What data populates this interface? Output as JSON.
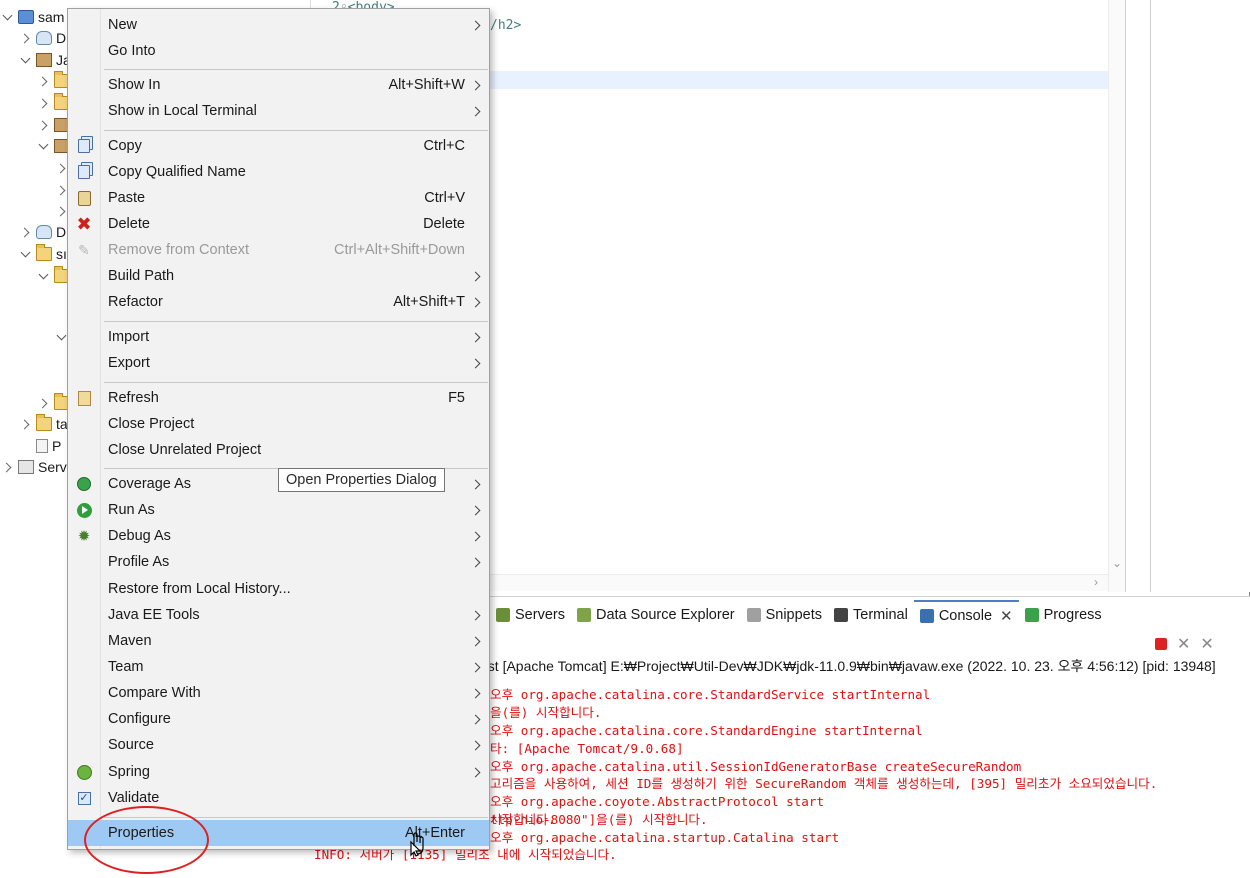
{
  "tree": {
    "items": [
      {
        "label": "sam",
        "indent": 0,
        "chevron": "down",
        "icon": "project-icon"
      },
      {
        "label": "D",
        "indent": 1,
        "chevron": "right",
        "icon": "descriptor-icon"
      },
      {
        "label": "Ja",
        "indent": 1,
        "chevron": "down",
        "icon": "java-resources-icon"
      },
      {
        "label": "",
        "indent": 2,
        "chevron": "right",
        "icon": "package-folder-icon"
      },
      {
        "label": "",
        "indent": 2,
        "chevron": "right",
        "icon": "package-folder-icon"
      },
      {
        "label": "",
        "indent": 2,
        "chevron": "right",
        "icon": "library-icon"
      },
      {
        "label": "",
        "indent": 2,
        "chevron": "down",
        "icon": "library-icon"
      },
      {
        "label": "",
        "indent": 3,
        "chevron": "right",
        "icon": ""
      },
      {
        "label": "",
        "indent": 3,
        "chevron": "right",
        "icon": ""
      },
      {
        "label": "",
        "indent": 3,
        "chevron": "right",
        "icon": ""
      },
      {
        "label": "D",
        "indent": 1,
        "chevron": "right",
        "icon": "deployed-resources-icon"
      },
      {
        "label": "sı",
        "indent": 1,
        "chevron": "down",
        "icon": "folder-icon"
      },
      {
        "label": "",
        "indent": 2,
        "chevron": "down",
        "icon": "folder-icon"
      },
      {
        "label": "",
        "indent": 3,
        "chevron": "down",
        "icon": ""
      },
      {
        "label": "",
        "indent": 2,
        "chevron": "right",
        "icon": "folder-icon"
      },
      {
        "label": "ta",
        "indent": 1,
        "chevron": "right",
        "icon": "folder-icon"
      },
      {
        "label": "P",
        "indent": 1,
        "chevron": "",
        "icon": "pom-file-icon"
      },
      {
        "label": "Serv",
        "indent": 0,
        "chevron": "right",
        "icon": "servers-folder-icon"
      }
    ]
  },
  "editor": {
    "lines": [
      "2◦<body>",
      "/h2>"
    ]
  },
  "context_menu": {
    "items": [
      {
        "label": "New",
        "key": "",
        "submenu": true,
        "icon": "",
        "state": "enabled"
      },
      {
        "label": "Go Into",
        "key": "",
        "submenu": false,
        "icon": "",
        "state": "enabled"
      },
      {
        "label": "Show In",
        "key": "Alt+Shift+W",
        "submenu": true,
        "icon": "",
        "state": "enabled"
      },
      {
        "label": "Show in Local Terminal",
        "key": "",
        "submenu": true,
        "icon": "",
        "state": "enabled"
      },
      {
        "label": "Copy",
        "key": "Ctrl+C",
        "submenu": false,
        "icon": "copy-icon",
        "state": "enabled"
      },
      {
        "label": "Copy Qualified Name",
        "key": "",
        "submenu": false,
        "icon": "copy-qualified-icon",
        "state": "enabled"
      },
      {
        "label": "Paste",
        "key": "Ctrl+V",
        "submenu": false,
        "icon": "paste-icon",
        "state": "enabled"
      },
      {
        "label": "Delete",
        "key": "Delete",
        "submenu": false,
        "icon": "delete-icon",
        "state": "enabled"
      },
      {
        "label": "Remove from Context",
        "key": "Ctrl+Alt+Shift+Down",
        "submenu": false,
        "icon": "remove-context-icon",
        "state": "disabled"
      },
      {
        "label": "Build Path",
        "key": "",
        "submenu": true,
        "icon": "",
        "state": "enabled"
      },
      {
        "label": "Refactor",
        "key": "Alt+Shift+T",
        "submenu": true,
        "icon": "",
        "state": "enabled"
      },
      {
        "label": "Import",
        "key": "",
        "submenu": true,
        "icon": "",
        "state": "enabled"
      },
      {
        "label": "Export",
        "key": "",
        "submenu": true,
        "icon": "",
        "state": "enabled"
      },
      {
        "label": "Refresh",
        "key": "F5",
        "submenu": false,
        "icon": "refresh-icon",
        "state": "enabled"
      },
      {
        "label": "Close Project",
        "key": "",
        "submenu": false,
        "icon": "",
        "state": "enabled"
      },
      {
        "label": "Close Unrelated Project",
        "key": "",
        "submenu": false,
        "icon": "",
        "state": "enabled"
      },
      {
        "label": "Coverage As",
        "key": "",
        "submenu": true,
        "icon": "coverage-icon",
        "state": "enabled"
      },
      {
        "label": "Run As",
        "key": "",
        "submenu": true,
        "icon": "run-icon",
        "state": "enabled"
      },
      {
        "label": "Debug As",
        "key": "",
        "submenu": true,
        "icon": "debug-icon",
        "state": "enabled"
      },
      {
        "label": "Profile As",
        "key": "",
        "submenu": true,
        "icon": "",
        "state": "enabled"
      },
      {
        "label": "Restore from Local History...",
        "key": "",
        "submenu": false,
        "icon": "",
        "state": "enabled"
      },
      {
        "label": "Java EE Tools",
        "key": "",
        "submenu": true,
        "icon": "",
        "state": "enabled"
      },
      {
        "label": "Maven",
        "key": "",
        "submenu": true,
        "icon": "",
        "state": "enabled"
      },
      {
        "label": "Team",
        "key": "",
        "submenu": true,
        "icon": "",
        "state": "enabled"
      },
      {
        "label": "Compare With",
        "key": "",
        "submenu": true,
        "icon": "",
        "state": "enabled"
      },
      {
        "label": "Configure",
        "key": "",
        "submenu": true,
        "icon": "",
        "state": "enabled"
      },
      {
        "label": "Source",
        "key": "",
        "submenu": true,
        "icon": "",
        "state": "enabled"
      },
      {
        "label": "Spring",
        "key": "",
        "submenu": true,
        "icon": "spring-icon",
        "state": "enabled"
      },
      {
        "label": "Validate",
        "key": "",
        "submenu": false,
        "icon": "validate-checkbox-icon",
        "state": "enabled"
      },
      {
        "label": "Properties",
        "key": "Alt+Enter",
        "submenu": false,
        "icon": "",
        "state": "selected"
      }
    ]
  },
  "tooltip": {
    "text": "Open Properties Dialog"
  },
  "bottom_tabs": [
    {
      "label": "Servers",
      "icon": "servers-icon",
      "active": false
    },
    {
      "label": "Data Source Explorer",
      "icon": "data-source-icon",
      "active": false
    },
    {
      "label": "Snippets",
      "icon": "snippets-icon",
      "active": false
    },
    {
      "label": "Terminal",
      "icon": "terminal-icon",
      "active": false
    },
    {
      "label": "Console",
      "icon": "console-icon",
      "active": true
    },
    {
      "label": "Progress",
      "icon": "progress-icon",
      "active": false
    }
  ],
  "console": {
    "header": "ost [Apache Tomcat] E:₩Project₩Util-Dev₩JDK₩jdk-11.0.9₩bin₩javaw.exe  (2022. 10. 23. 오후 4:56:12) [pid: 13948]",
    "lines": [
      "오후 org.apache.catalina.core.StandardService startInternal",
      "을(를) 시작합니다.",
      "오후 org.apache.catalina.core.StandardEngine startInternal",
      "타: [Apache Tomcat/9.0.68]",
      "오후 org.apache.catalina.util.SessionIdGeneratorBase createSecureRandom",
      "고리즘을 사용하여, 세션 ID를 생성하기 위한 SecureRandom 객체를 생성하는데, [395] 밀리초가 소요되었습니다.",
      "오후 org.apache.coyote.AbstractProtocol start",
      "시작합니다.",
      "ttp-nio-8080\"]을(를) 시작합니다.",
      "오후 org.apache.catalina.startup.Catalina start",
      "INFO: 서버가 [1135] 밀리초 내에 시작되었습니다."
    ]
  },
  "colors": {
    "menu_bg": "#f2f2f2",
    "selected_bg": "#9dc9f2",
    "console_text": "#e01010",
    "annotation": "#e02020"
  }
}
